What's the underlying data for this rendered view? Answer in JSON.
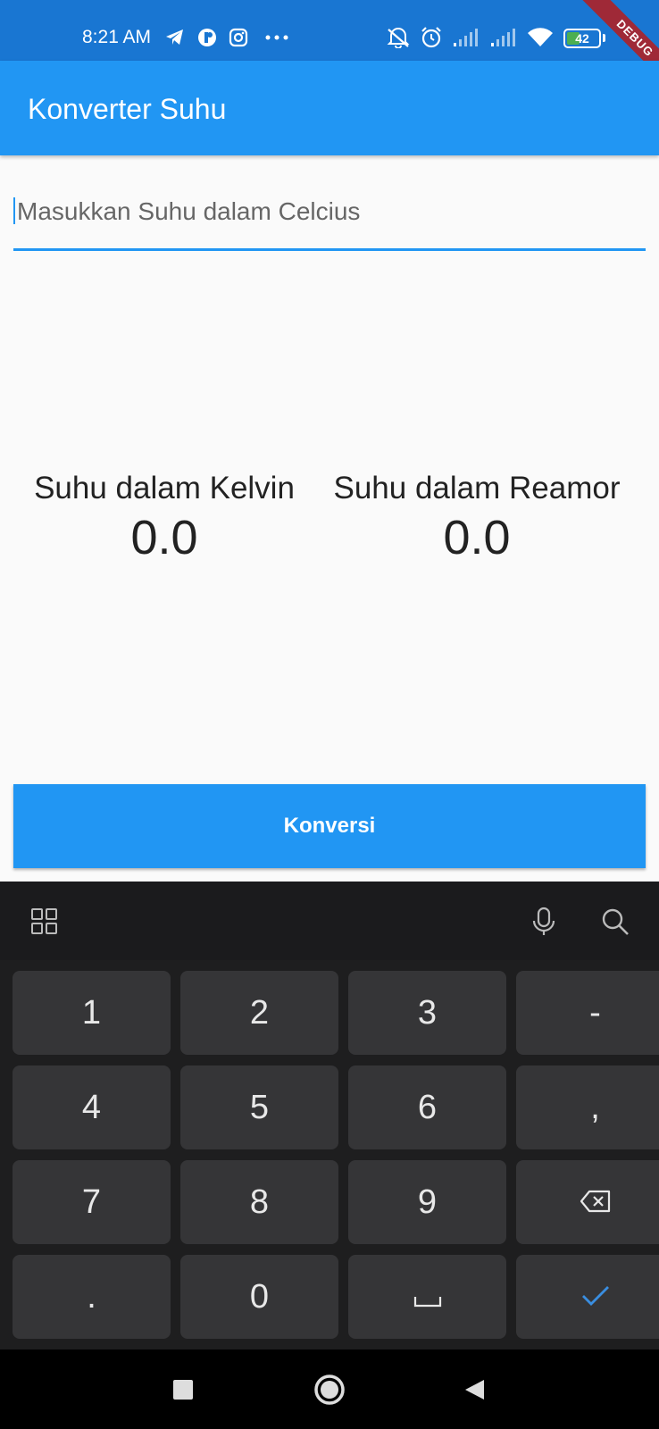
{
  "status_bar": {
    "time": "8:21 AM",
    "battery_level": "42",
    "battery_fraction": 0.42,
    "icons": [
      "telegram-icon",
      "app-icon",
      "instagram-icon",
      "more-notifications-icon",
      "mute-icon",
      "alarm-icon",
      "signal-icon",
      "signal-icon",
      "wifi-icon",
      "battery-icon"
    ]
  },
  "debug_banner": "DEBUG",
  "app_bar": {
    "title": "Konverter Suhu"
  },
  "input": {
    "placeholder": "Masukkan Suhu dalam Celcius",
    "value": ""
  },
  "results": {
    "kelvin": {
      "label": "Suhu dalam Kelvin",
      "value": "0.0"
    },
    "reamur": {
      "label": "Suhu dalam Reamor",
      "value": "0.0"
    }
  },
  "button": {
    "label": "Konversi"
  },
  "keyboard": {
    "toolbar_icons": [
      "grid-icon",
      "microphone-icon",
      "search-icon"
    ],
    "keys": [
      [
        "1",
        "2",
        "3",
        "-"
      ],
      [
        "4",
        "5",
        "6",
        ","
      ],
      [
        "7",
        "8",
        "9",
        "backspace-icon"
      ],
      [
        ".",
        "0",
        "space-icon",
        "checkmark-icon"
      ]
    ]
  },
  "nav_bar": {
    "icons": [
      "recent-apps-icon",
      "home-icon",
      "back-icon"
    ]
  },
  "colors": {
    "status_bar": "#1976d2",
    "app_bar": "#2196f3",
    "accent": "#2196f3",
    "keyboard_bg": "#1e1e1f",
    "key_bg": "#353537",
    "nav_bar": "#000000"
  }
}
